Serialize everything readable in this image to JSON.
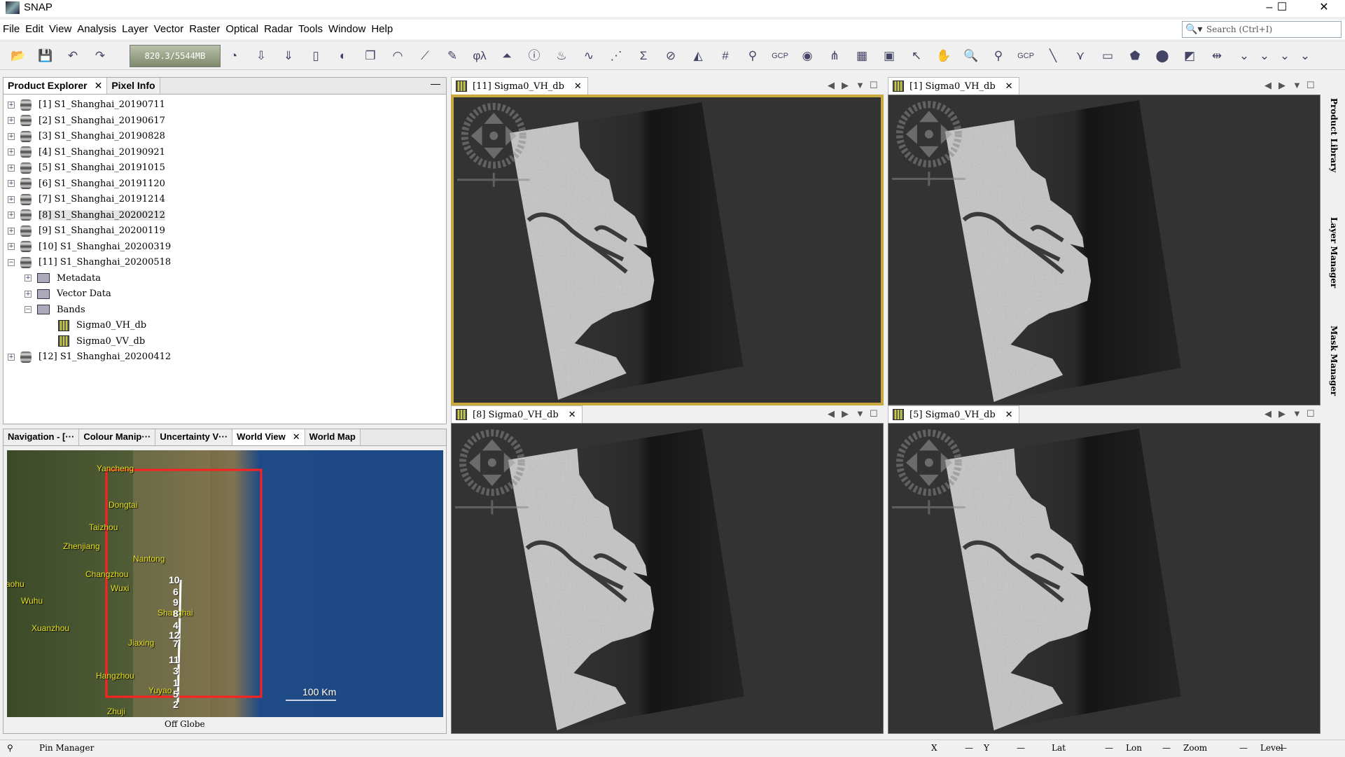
{
  "window": {
    "title": "SNAP",
    "minimize": "–",
    "maximize": "☐",
    "close": "✕"
  },
  "menu": [
    "File",
    "Edit",
    "View",
    "Analysis",
    "Layer",
    "Vector",
    "Raster",
    "Optical",
    "Radar",
    "Tools",
    "Window",
    "Help"
  ],
  "search": {
    "placeholder": "Search (Ctrl+I)",
    "icon": "search-icon"
  },
  "toolbar": {
    "memory": "820.3/5544MB",
    "icons": [
      {
        "name": "open-product-icon",
        "g": "📂"
      },
      {
        "name": "save-product-icon",
        "g": "💾"
      },
      {
        "name": "undo-icon",
        "g": "↶"
      },
      {
        "name": "redo-icon",
        "g": "↷"
      },
      {
        "name": "gc-icon",
        "g": "◔"
      },
      {
        "name": "import-icon",
        "g": "⇩"
      },
      {
        "name": "export-icon",
        "g": "⇓"
      },
      {
        "name": "session-icon",
        "g": "▯"
      },
      {
        "name": "rgb-image-icon",
        "g": "◐"
      },
      {
        "name": "new-window-icon",
        "g": "❐"
      },
      {
        "name": "wave-icon",
        "g": "◠"
      },
      {
        "name": "spectrum-icon",
        "g": "⟋"
      },
      {
        "name": "band-maths-icon",
        "g": "✎"
      },
      {
        "name": "geo-coding-icon",
        "g": "φλ"
      },
      {
        "name": "histogram-icon",
        "g": "⏶"
      },
      {
        "name": "information-icon",
        "g": "ⓘ"
      },
      {
        "name": "statistics-icon",
        "g": "♨"
      },
      {
        "name": "profile-plot-icon",
        "g": "∿"
      },
      {
        "name": "scatter-plot-icon",
        "g": "⋰"
      },
      {
        "name": "sum-icon",
        "g": "Σ"
      },
      {
        "name": "no-data-overlay-icon",
        "g": "⊘"
      },
      {
        "name": "shape-overlay-icon",
        "g": "◭"
      },
      {
        "name": "graticule-icon",
        "g": "#"
      },
      {
        "name": "pin-overlay-icon",
        "g": "⚲"
      },
      {
        "name": "gcp-overlay-icon",
        "g": "GCP"
      },
      {
        "name": "world-overlay-icon",
        "g": "◉"
      },
      {
        "name": "graph-builder-icon",
        "g": "⋔"
      },
      {
        "name": "batch-icon",
        "g": "▦"
      },
      {
        "name": "world-map-icon",
        "g": "▣"
      },
      {
        "name": "select-icon",
        "g": "↖"
      },
      {
        "name": "pan-icon",
        "g": "✋"
      },
      {
        "name": "zoom-icon",
        "g": "🔍"
      },
      {
        "name": "pin-placing-icon",
        "g": "⚲"
      },
      {
        "name": "gcp-placing-icon",
        "g": "GCP"
      },
      {
        "name": "line-draw-icon",
        "g": "╲"
      },
      {
        "name": "polyline-draw-icon",
        "g": "⋎"
      },
      {
        "name": "rectangle-draw-icon",
        "g": "▭"
      },
      {
        "name": "polygon-draw-icon",
        "g": "⬟"
      },
      {
        "name": "ellipse-draw-icon",
        "g": "⬤"
      },
      {
        "name": "new-vector-icon",
        "g": "◩"
      },
      {
        "name": "range-finder-icon",
        "g": "⇹"
      },
      {
        "name": "more-icon",
        "g": "⌄"
      },
      {
        "name": "more-icon-2",
        "g": "⌄"
      },
      {
        "name": "more-icon-3",
        "g": "⌄"
      },
      {
        "name": "more-icon-4",
        "g": "⌄"
      }
    ]
  },
  "explorer": {
    "tabs": [
      "Product Explorer",
      "Pixel Info"
    ],
    "close": "✕",
    "minimize": "—",
    "products": [
      "[1] S1_Shanghai_20190711",
      "[2] S1_Shanghai_20190617",
      "[3] S1_Shanghai_20190828",
      "[4] S1_Shanghai_20190921",
      "[5] S1_Shanghai_20191015",
      "[6] S1_Shanghai_20191120",
      "[7] S1_Shanghai_20191214",
      "[8] S1_Shanghai_20200212",
      "[9] S1_Shanghai_20200119",
      "[10] S1_Shanghai_20200319",
      "[11] S1_Shanghai_20200518"
    ],
    "children": [
      "Metadata",
      "Vector Data",
      "Bands"
    ],
    "bands": [
      "Sigma0_VH_db",
      "Sigma0_VV_db"
    ],
    "last": "[12] S1_Shanghai_20200412",
    "selected": "[8] S1_Shanghai_20200212"
  },
  "views": [
    {
      "title": "[11] Sigma0_VH_db",
      "selected": true
    },
    {
      "title": "[1] Sigma0_VH_db",
      "selected": false
    },
    {
      "title": "[8] Sigma0_VH_db",
      "selected": false
    },
    {
      "title": "[5] Sigma0_VH_db",
      "selected": false
    }
  ],
  "bottom": {
    "tabs": [
      "Navigation - [···",
      "Colour Manip···",
      "Uncertainty V···",
      "World View",
      "World Map"
    ],
    "active": "World View",
    "status": "Off Globe",
    "cities": [
      "Yancheng",
      "Dongtai",
      "Taizhou",
      "Zhenjiang",
      "Nantong",
      "Changzhou",
      "Wuxi",
      "aohu",
      "Wuhu",
      "Shanghai",
      "Xuanzhou",
      "Jiaxing",
      "Hangzhou",
      "Yuyao",
      "Zhuji"
    ],
    "footprint_labels": [
      "10",
      "6",
      "9",
      "8",
      "4",
      "12",
      "7",
      "11",
      "3",
      "1",
      "5",
      "2"
    ],
    "scale": "100 Km",
    "footprint_color": "#ff2020",
    "ocean_color": "#1d4886"
  },
  "rightbar": [
    "Product Library",
    "Layer Manager",
    "Mask Manager"
  ],
  "status": {
    "pin": "Pin Manager",
    "fields": [
      "X",
      "—",
      "Y",
      "—",
      "Lat",
      "—",
      "Lon",
      "—",
      "Zoom",
      "—",
      "Level",
      "—"
    ]
  },
  "colors": {
    "selected_view_border": "#c9a840",
    "canvas_bg": "#333333"
  }
}
